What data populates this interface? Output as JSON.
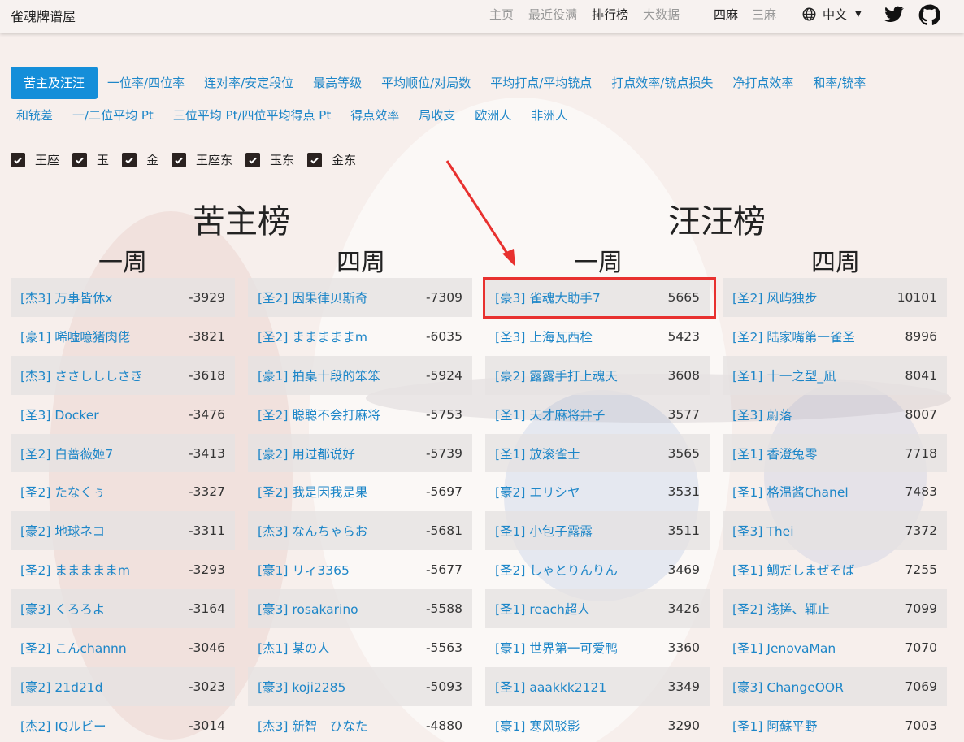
{
  "navbar": {
    "brand": "雀魂牌谱屋",
    "links": [
      "主页",
      "最近役满",
      "排行榜",
      "大数据"
    ],
    "active_link": 2,
    "modes": [
      "四麻",
      "三麻"
    ],
    "active_mode": 0,
    "language": "中文",
    "icons": [
      "globe-icon",
      "caret-down-icon",
      "twitter-icon",
      "github-icon"
    ]
  },
  "tabs": {
    "row1": [
      "苦主及汪汪",
      "一位率/四位率",
      "连对率/安定段位",
      "最高等级",
      "平均顺位/对局数",
      "平均打点/平均铳点",
      "打点效率/铳点损失",
      "净打点效率",
      "和率/铳率"
    ],
    "row2": [
      "和铳差",
      "一/二位平均 Pt",
      "三位平均 Pt/四位平均得点 Pt",
      "得点效率",
      "局收支",
      "欧洲人",
      "非洲人"
    ],
    "active": "苦主及汪汪"
  },
  "filters": [
    "王座",
    "玉",
    "金",
    "王座东",
    "玉东",
    "金东"
  ],
  "boards": {
    "kuzhu": {
      "title": "苦主榜",
      "week1": "一周",
      "week4": "四周"
    },
    "wangwang": {
      "title": "汪汪榜",
      "week1": "一周",
      "week4": "四周"
    }
  },
  "lists": {
    "kuzhu_w1": [
      {
        "name": "[杰3] 万事皆休x",
        "score": "-3929"
      },
      {
        "name": "[豪1] 唏嘘噫猪肉佬",
        "score": "-3821"
      },
      {
        "name": "[杰3] ささしししさき",
        "score": "-3618"
      },
      {
        "name": "[圣3] Docker",
        "score": "-3476"
      },
      {
        "name": "[圣2] 白蔷薇姬7",
        "score": "-3413"
      },
      {
        "name": "[圣2] たなくぅ",
        "score": "-3327"
      },
      {
        "name": "[豪2] 地球ネコ",
        "score": "-3311"
      },
      {
        "name": "[圣2] まままままm",
        "score": "-3293"
      },
      {
        "name": "[豪3] くろろよ",
        "score": "-3164"
      },
      {
        "name": "[圣2] こんchannn",
        "score": "-3046"
      },
      {
        "name": "[豪2] 21d21d",
        "score": "-3023"
      },
      {
        "name": "[杰2] IQルビー",
        "score": "-3014"
      }
    ],
    "kuzhu_w4": [
      {
        "name": "[圣2] 因果律贝斯奇",
        "score": "-7309"
      },
      {
        "name": "[圣2] まままままm",
        "score": "-6035"
      },
      {
        "name": "[豪1] 拍桌十段的笨笨",
        "score": "-5924"
      },
      {
        "name": "[圣2] 聪聪不会打麻将",
        "score": "-5753"
      },
      {
        "name": "[豪2] 用过都说好",
        "score": "-5739"
      },
      {
        "name": "[圣2] 我是因我是果",
        "score": "-5697"
      },
      {
        "name": "[杰3] なんちゃらお",
        "score": "-5681"
      },
      {
        "name": "[豪1] リィ3365",
        "score": "-5677"
      },
      {
        "name": "[豪3] rosakarino",
        "score": "-5588"
      },
      {
        "name": "[杰1] 某の人",
        "score": "-5563"
      },
      {
        "name": "[豪3] koji2285",
        "score": "-5093"
      },
      {
        "name": "[杰3] 新智　ひなた",
        "score": "-4880"
      }
    ],
    "wangwang_w1": [
      {
        "name": "[豪3] 雀魂大助手7",
        "score": "5665"
      },
      {
        "name": "[圣3] 上海瓦西栓",
        "score": "5423"
      },
      {
        "name": "[豪2] 露露手打上魂天",
        "score": "3608"
      },
      {
        "name": "[圣1] 天才麻将井子",
        "score": "3577"
      },
      {
        "name": "[圣1] 放滚雀士",
        "score": "3565"
      },
      {
        "name": "[豪2] エリシヤ",
        "score": "3531"
      },
      {
        "name": "[圣1] 小包子露露",
        "score": "3511"
      },
      {
        "name": "[圣2] しゃとりんりん",
        "score": "3469"
      },
      {
        "name": "[圣1] reach超人",
        "score": "3426"
      },
      {
        "name": "[豪1] 世界第一可爱鸭",
        "score": "3360"
      },
      {
        "name": "[圣1] aaakkk2121",
        "score": "3349"
      },
      {
        "name": "[豪1] 寒风驳影",
        "score": "3290"
      }
    ],
    "wangwang_w4": [
      {
        "name": "[圣2] 风屿独步",
        "score": "10101"
      },
      {
        "name": "[圣2] 陆家嘴第一雀圣",
        "score": "8996"
      },
      {
        "name": "[圣1] 十一之型_凪",
        "score": "8041"
      },
      {
        "name": "[圣3] 蔚落",
        "score": "8007"
      },
      {
        "name": "[圣1] 香澄兔零",
        "score": "7718"
      },
      {
        "name": "[圣1] 格温酱Chanel",
        "score": "7483"
      },
      {
        "name": "[圣3] Thei",
        "score": "7372"
      },
      {
        "name": "[圣1] 鯛だしまぜそば",
        "score": "7255"
      },
      {
        "name": "[圣2] 浅搓、辄止",
        "score": "7099"
      },
      {
        "name": "[圣1] JenovaMan",
        "score": "7070"
      },
      {
        "name": "[豪3] ChangeOOR",
        "score": "7069"
      },
      {
        "name": "[圣1] 阿蘇平野",
        "score": "7003"
      }
    ]
  },
  "colors": {
    "link": "#1d86c8",
    "active_tab_bg": "#148ed9",
    "highlight": "#e8312f"
  }
}
